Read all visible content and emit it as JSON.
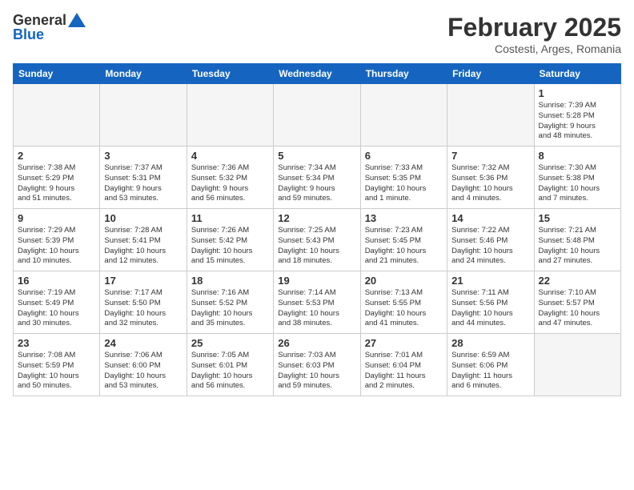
{
  "header": {
    "logo_general": "General",
    "logo_blue": "Blue",
    "month_year": "February 2025",
    "location": "Costesti, Arges, Romania"
  },
  "weekdays": [
    "Sunday",
    "Monday",
    "Tuesday",
    "Wednesday",
    "Thursday",
    "Friday",
    "Saturday"
  ],
  "weeks": [
    [
      {
        "day": "",
        "info": ""
      },
      {
        "day": "",
        "info": ""
      },
      {
        "day": "",
        "info": ""
      },
      {
        "day": "",
        "info": ""
      },
      {
        "day": "",
        "info": ""
      },
      {
        "day": "",
        "info": ""
      },
      {
        "day": "1",
        "info": "Sunrise: 7:39 AM\nSunset: 5:28 PM\nDaylight: 9 hours\nand 48 minutes."
      }
    ],
    [
      {
        "day": "2",
        "info": "Sunrise: 7:38 AM\nSunset: 5:29 PM\nDaylight: 9 hours\nand 51 minutes."
      },
      {
        "day": "3",
        "info": "Sunrise: 7:37 AM\nSunset: 5:31 PM\nDaylight: 9 hours\nand 53 minutes."
      },
      {
        "day": "4",
        "info": "Sunrise: 7:36 AM\nSunset: 5:32 PM\nDaylight: 9 hours\nand 56 minutes."
      },
      {
        "day": "5",
        "info": "Sunrise: 7:34 AM\nSunset: 5:34 PM\nDaylight: 9 hours\nand 59 minutes."
      },
      {
        "day": "6",
        "info": "Sunrise: 7:33 AM\nSunset: 5:35 PM\nDaylight: 10 hours\nand 1 minute."
      },
      {
        "day": "7",
        "info": "Sunrise: 7:32 AM\nSunset: 5:36 PM\nDaylight: 10 hours\nand 4 minutes."
      },
      {
        "day": "8",
        "info": "Sunrise: 7:30 AM\nSunset: 5:38 PM\nDaylight: 10 hours\nand 7 minutes."
      }
    ],
    [
      {
        "day": "9",
        "info": "Sunrise: 7:29 AM\nSunset: 5:39 PM\nDaylight: 10 hours\nand 10 minutes."
      },
      {
        "day": "10",
        "info": "Sunrise: 7:28 AM\nSunset: 5:41 PM\nDaylight: 10 hours\nand 12 minutes."
      },
      {
        "day": "11",
        "info": "Sunrise: 7:26 AM\nSunset: 5:42 PM\nDaylight: 10 hours\nand 15 minutes."
      },
      {
        "day": "12",
        "info": "Sunrise: 7:25 AM\nSunset: 5:43 PM\nDaylight: 10 hours\nand 18 minutes."
      },
      {
        "day": "13",
        "info": "Sunrise: 7:23 AM\nSunset: 5:45 PM\nDaylight: 10 hours\nand 21 minutes."
      },
      {
        "day": "14",
        "info": "Sunrise: 7:22 AM\nSunset: 5:46 PM\nDaylight: 10 hours\nand 24 minutes."
      },
      {
        "day": "15",
        "info": "Sunrise: 7:21 AM\nSunset: 5:48 PM\nDaylight: 10 hours\nand 27 minutes."
      }
    ],
    [
      {
        "day": "16",
        "info": "Sunrise: 7:19 AM\nSunset: 5:49 PM\nDaylight: 10 hours\nand 30 minutes."
      },
      {
        "day": "17",
        "info": "Sunrise: 7:17 AM\nSunset: 5:50 PM\nDaylight: 10 hours\nand 32 minutes."
      },
      {
        "day": "18",
        "info": "Sunrise: 7:16 AM\nSunset: 5:52 PM\nDaylight: 10 hours\nand 35 minutes."
      },
      {
        "day": "19",
        "info": "Sunrise: 7:14 AM\nSunset: 5:53 PM\nDaylight: 10 hours\nand 38 minutes."
      },
      {
        "day": "20",
        "info": "Sunrise: 7:13 AM\nSunset: 5:55 PM\nDaylight: 10 hours\nand 41 minutes."
      },
      {
        "day": "21",
        "info": "Sunrise: 7:11 AM\nSunset: 5:56 PM\nDaylight: 10 hours\nand 44 minutes."
      },
      {
        "day": "22",
        "info": "Sunrise: 7:10 AM\nSunset: 5:57 PM\nDaylight: 10 hours\nand 47 minutes."
      }
    ],
    [
      {
        "day": "23",
        "info": "Sunrise: 7:08 AM\nSunset: 5:59 PM\nDaylight: 10 hours\nand 50 minutes."
      },
      {
        "day": "24",
        "info": "Sunrise: 7:06 AM\nSunset: 6:00 PM\nDaylight: 10 hours\nand 53 minutes."
      },
      {
        "day": "25",
        "info": "Sunrise: 7:05 AM\nSunset: 6:01 PM\nDaylight: 10 hours\nand 56 minutes."
      },
      {
        "day": "26",
        "info": "Sunrise: 7:03 AM\nSunset: 6:03 PM\nDaylight: 10 hours\nand 59 minutes."
      },
      {
        "day": "27",
        "info": "Sunrise: 7:01 AM\nSunset: 6:04 PM\nDaylight: 11 hours\nand 2 minutes."
      },
      {
        "day": "28",
        "info": "Sunrise: 6:59 AM\nSunset: 6:06 PM\nDaylight: 11 hours\nand 6 minutes."
      },
      {
        "day": "",
        "info": ""
      }
    ]
  ]
}
